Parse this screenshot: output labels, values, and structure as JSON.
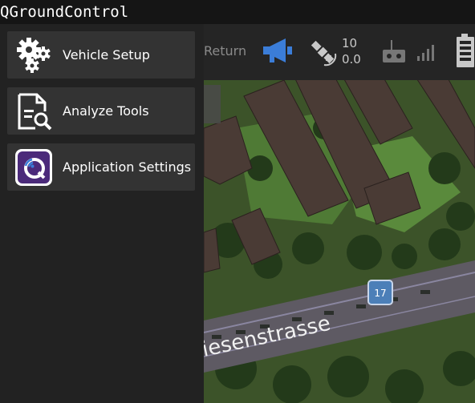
{
  "window": {
    "title": "QGroundControl"
  },
  "menu": {
    "items": [
      {
        "label": "Vehicle Setup",
        "icon": "gears-icon"
      },
      {
        "label": "Analyze Tools",
        "icon": "analyze-document-icon"
      },
      {
        "label": "Application Settings",
        "icon": "qgc-app-icon"
      }
    ]
  },
  "toolbar": {
    "return_label": "Return",
    "gps_satellites": "10",
    "gps_hdop": "0.0",
    "colors": {
      "megaphone": "#3b7dd8",
      "icon_gray": "#c8c8c8",
      "dim_gray": "#777777"
    }
  },
  "map": {
    "street_label": "iesenstrasse",
    "road_marker": "17"
  }
}
